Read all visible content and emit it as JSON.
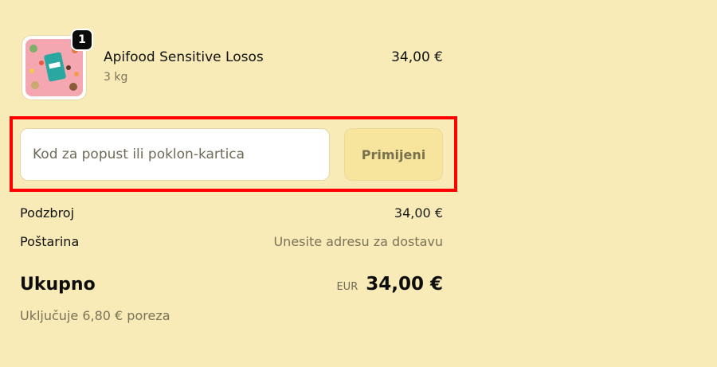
{
  "product": {
    "name": "Apifood Sensitive Losos",
    "variant": "3 kg",
    "price": "34,00 €",
    "quantity": "1",
    "image_icon": "pet-food-package-image",
    "image_bg_color": "#f4a7b0"
  },
  "discount": {
    "placeholder": "Kod za popust ili poklon-kartica",
    "value": "",
    "apply_label": "Primijeni"
  },
  "summary": {
    "subtotal_label": "Podzbroj",
    "subtotal_value": "34,00 €",
    "shipping_label": "Poštarina",
    "shipping_value": "Unesite adresu za dostavu",
    "total_label": "Ukupno",
    "currency": "EUR",
    "total_value": "34,00 €",
    "tax_note": "Uključuje 6,80 € poreza"
  },
  "colors": {
    "page_background": "#f8ebb7",
    "highlight_border": "#ff0000",
    "apply_button_bg": "#f7e49d"
  }
}
